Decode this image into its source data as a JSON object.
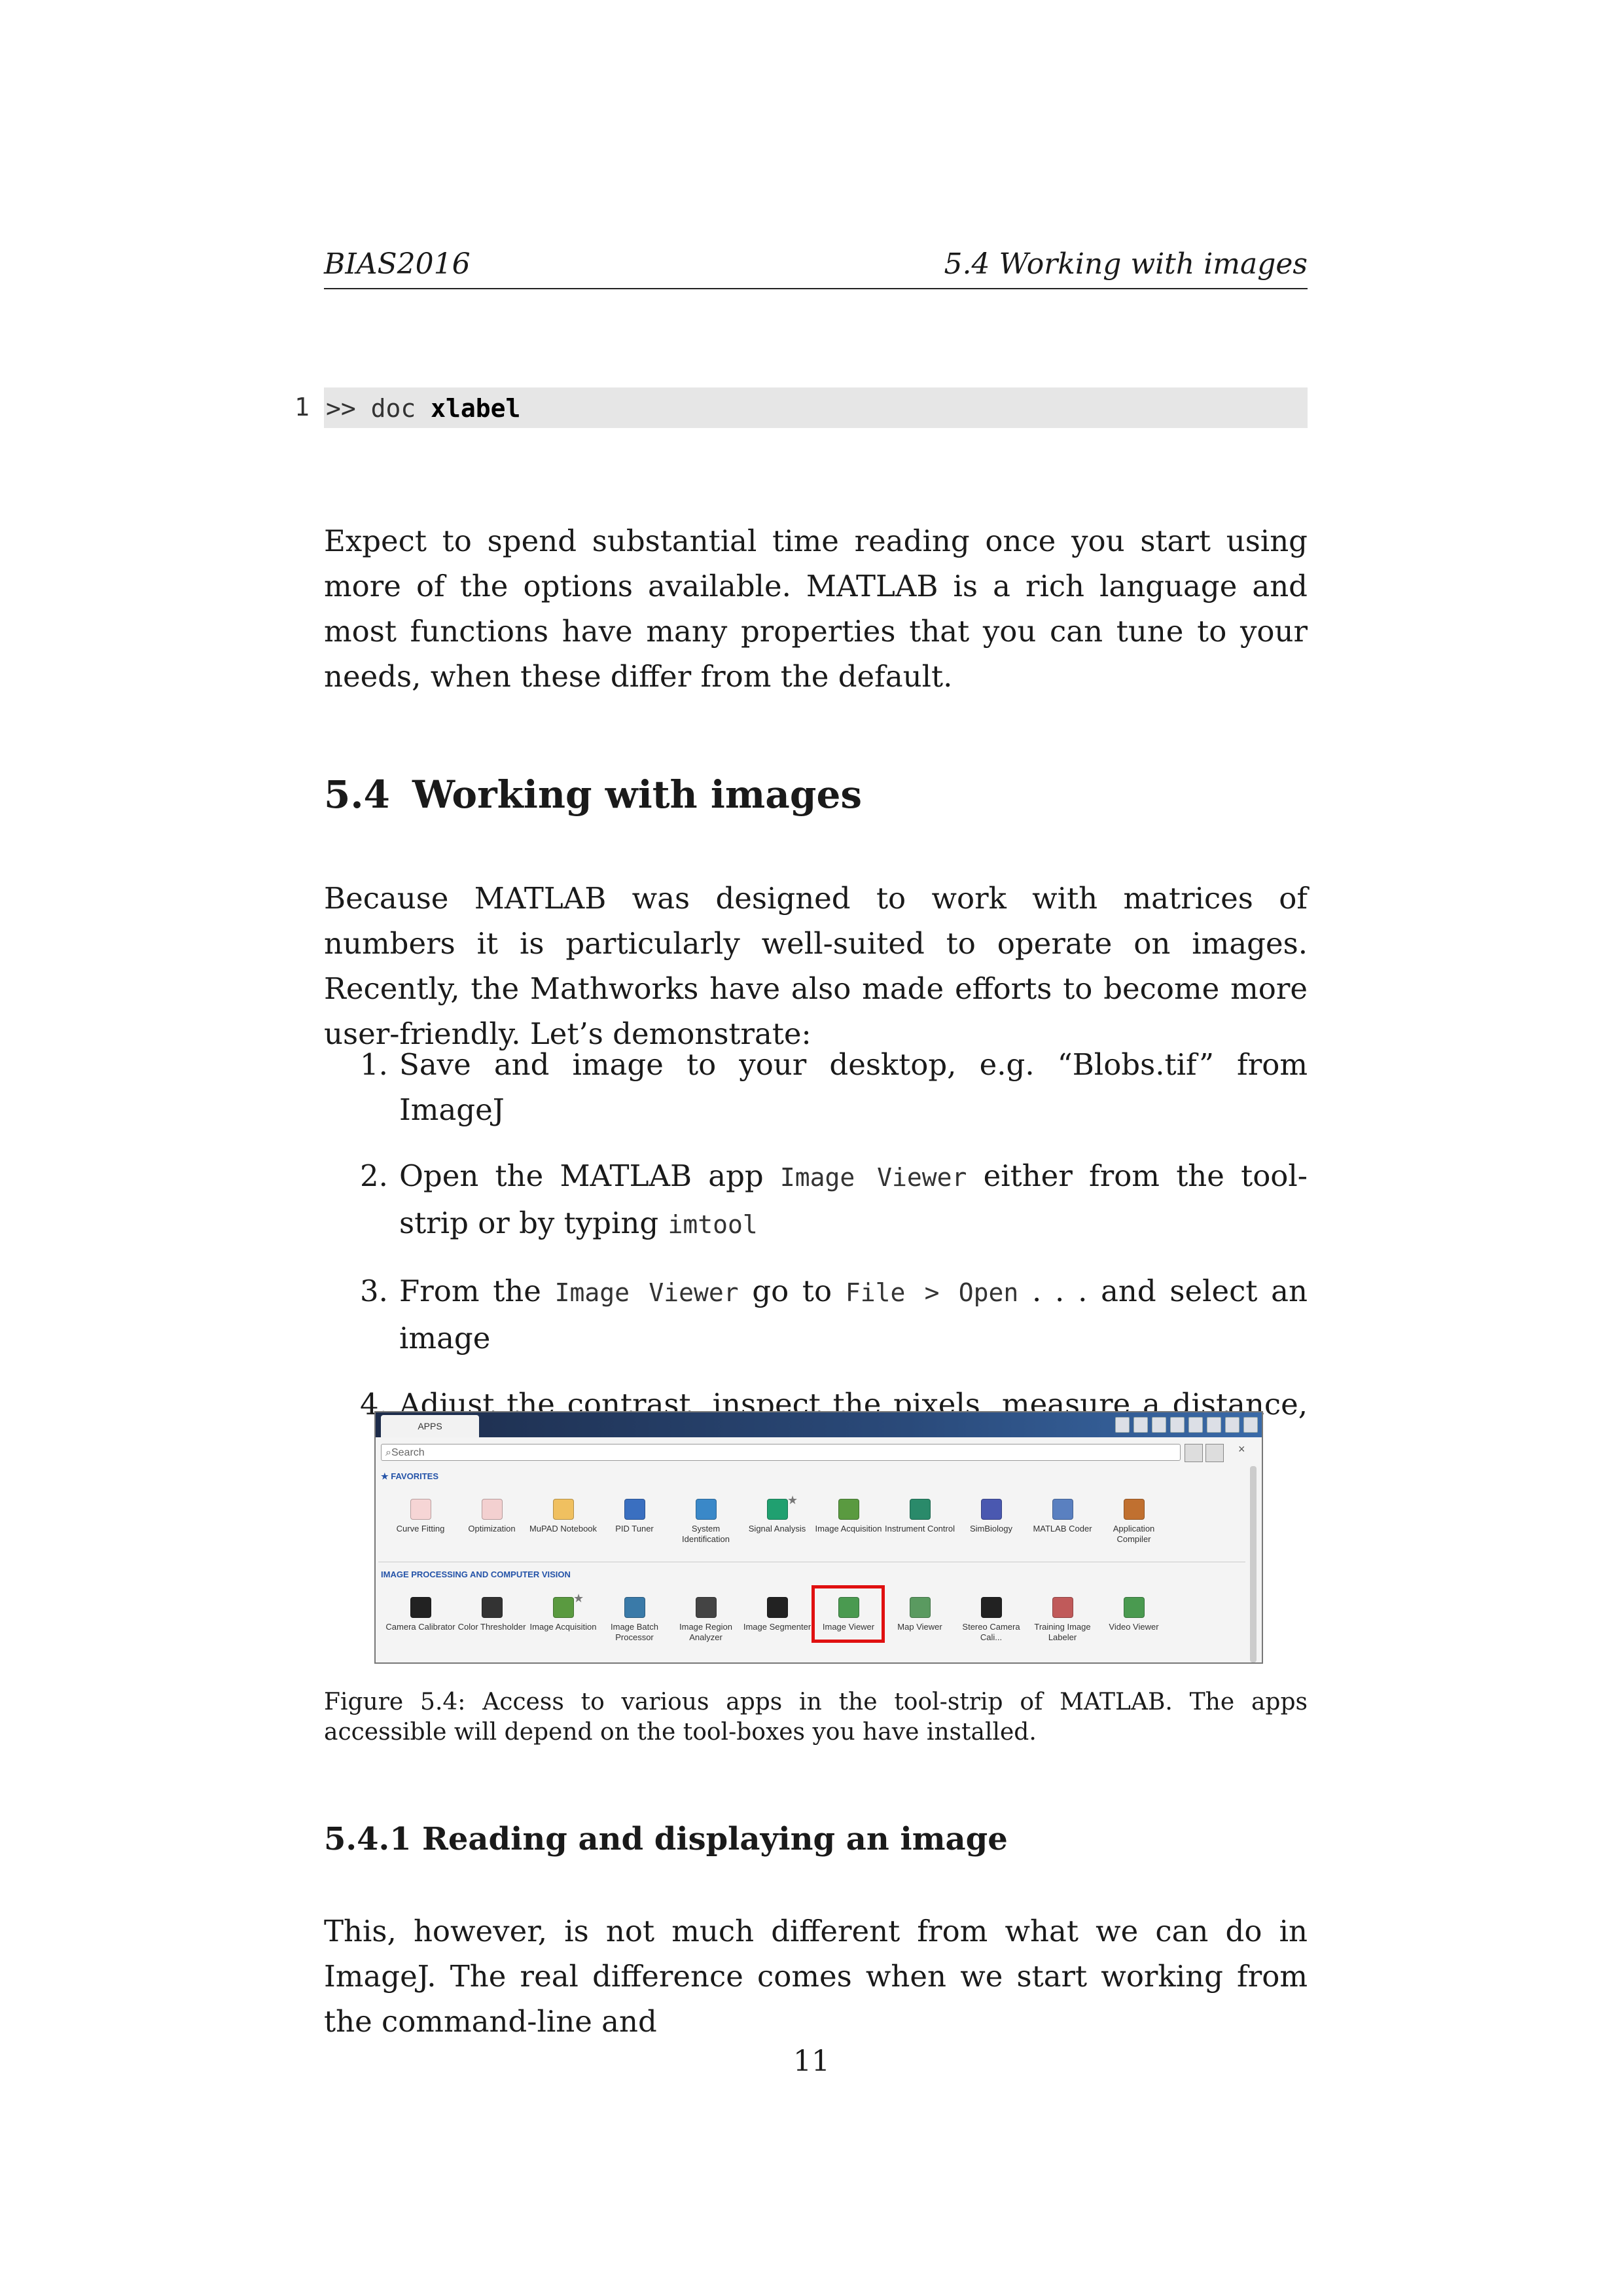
{
  "header": {
    "left": "BIAS2016",
    "right": "5.4 Working with images"
  },
  "code": {
    "line_number": "1",
    "prompt": ">> doc ",
    "keyword": "xlabel"
  },
  "paragraph1": "Expect to spend substantial time reading once you start using more of the options available. MATLAB is a rich language and most functions have many properties that you can tune to your needs, when these differ from the default.",
  "section": {
    "number": "5.4",
    "title": "Working with images"
  },
  "paragraph2": "Because MATLAB was designed to work with matrices of numbers it is particularly well-suited to operate on images. Recently, the Mathworks have also made efforts to become more user-friendly. Let’s demonstrate:",
  "list": [
    {
      "n": "1.",
      "parts": [
        {
          "t": "Save and image to your desktop, e.g. “Blobs.tif” from ImageJ"
        }
      ]
    },
    {
      "n": "2.",
      "parts": [
        {
          "t": "Open the MATLAB app "
        },
        {
          "t": "Image Viewer",
          "mono": true
        },
        {
          "t": " either from the tool-strip or by typing "
        },
        {
          "t": "imtool",
          "mono": true
        }
      ]
    },
    {
      "n": "3.",
      "parts": [
        {
          "t": "From the "
        },
        {
          "t": "Image Viewer",
          "mono": true
        },
        {
          "t": " go to "
        },
        {
          "t": "File > Open",
          "mono": true
        },
        {
          "t": " . . . and select an image"
        }
      ]
    },
    {
      "n": "4.",
      "parts": [
        {
          "t": "Adjust the contrast, inspect the pixels, measure a distance, etc, using the tool-strip shortcuts"
        }
      ]
    }
  ],
  "screenshot": {
    "tab": "APPS",
    "search_placeholder": "Search",
    "close": "×",
    "favorites_label": "FAVORITES",
    "favorites": [
      {
        "label": "Curve Fitting",
        "icon": "curve-fitting-icon",
        "color": "#f6d5d5"
      },
      {
        "label": "Optimization",
        "icon": "optimization-icon",
        "color": "#f3d0d0"
      },
      {
        "label": "MuPAD Notebook",
        "icon": "mupad-icon",
        "color": "#f0c060"
      },
      {
        "label": "PID Tuner",
        "icon": "pid-tuner-icon",
        "color": "#3a6fc0"
      },
      {
        "label": "System Identification",
        "icon": "system-id-icon",
        "color": "#3a88c8"
      },
      {
        "label": "Signal Analysis",
        "icon": "signal-analysis-icon",
        "color": "#20a070",
        "starred": true
      },
      {
        "label": "Image Acquisition",
        "icon": "image-acquisition-icon",
        "color": "#5a9a40"
      },
      {
        "label": "Instrument Control",
        "icon": "instrument-control-icon",
        "color": "#2a8a6a"
      },
      {
        "label": "SimBiology",
        "icon": "simbiology-icon",
        "color": "#4a58b0"
      },
      {
        "label": "MATLAB Coder",
        "icon": "matlab-coder-icon",
        "color": "#5a80c0"
      },
      {
        "label": "Application Compiler",
        "icon": "application-compiler-icon",
        "color": "#c07030"
      }
    ],
    "ip_label": "IMAGE PROCESSING AND COMPUTER VISION",
    "image_apps": [
      {
        "label": "Camera Calibrator",
        "icon": "camera-calibrator-icon",
        "color": "#222222"
      },
      {
        "label": "Color Thresholder",
        "icon": "color-thresholder-icon",
        "color": "#333333"
      },
      {
        "label": "Image Acquisition",
        "icon": "image-acquisition-icon",
        "color": "#5a9a40",
        "starred": true
      },
      {
        "label": "Image Batch Processor",
        "icon": "image-batch-processor-icon",
        "color": "#3a7aa8"
      },
      {
        "label": "Image Region Analyzer",
        "icon": "image-region-analyzer-icon",
        "color": "#444444"
      },
      {
        "label": "Image Segmenter",
        "icon": "image-segmenter-icon",
        "color": "#222222"
      },
      {
        "label": "Image Viewer",
        "icon": "image-viewer-icon",
        "color": "#4a9a50"
      },
      {
        "label": "Map Viewer",
        "icon": "map-viewer-icon",
        "color": "#5a9a60"
      },
      {
        "label": "Stereo Camera Cali...",
        "icon": "stereo-camera-icon",
        "color": "#222222"
      },
      {
        "label": "Training Image Labeler",
        "icon": "training-labeler-icon",
        "color": "#c05a5a"
      },
      {
        "label": "Video Viewer",
        "icon": "video-viewer-icon",
        "color": "#4a9a50"
      }
    ]
  },
  "caption": "Figure 5.4: Access to various apps in the tool-strip of MATLAB. The apps accessible will depend on the tool-boxes you have installed.",
  "subsection": {
    "number": "5.4.1",
    "title": "Reading and displaying an image"
  },
  "paragraph3": "This, however, is not much different from what we can do in ImageJ. The real difference comes when we start working from the command-line and",
  "page_number": "11"
}
